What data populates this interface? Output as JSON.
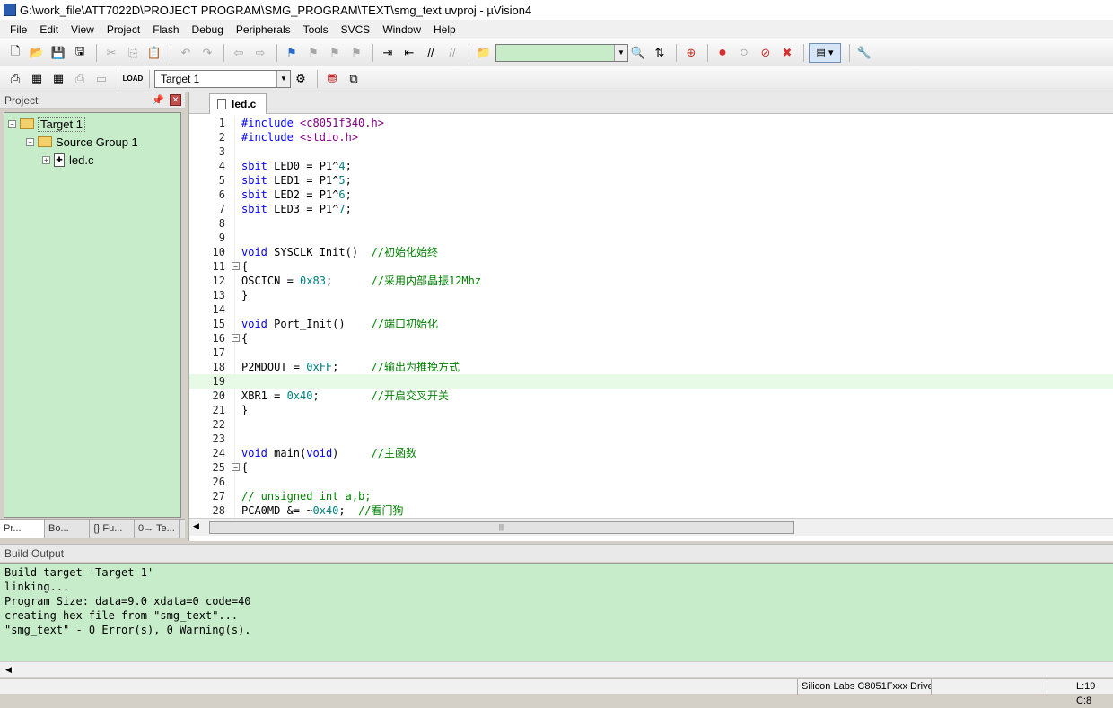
{
  "window": {
    "title": "G:\\work_file\\ATT7022D\\PROJECT PROGRAM\\SMG_PROGRAM\\TEXT\\smg_text.uvproj - µVision4"
  },
  "menu": [
    "File",
    "Edit",
    "View",
    "Project",
    "Flash",
    "Debug",
    "Peripherals",
    "Tools",
    "SVCS",
    "Window",
    "Help"
  ],
  "toolbar": {
    "target_select": "Target 1",
    "find_value": ""
  },
  "project_pane": {
    "title": "Project",
    "tree": {
      "target": "Target 1",
      "group": "Source Group 1",
      "file": "led.c"
    },
    "tabs": [
      "Pr...",
      "Bo...",
      "{} Fu...",
      "0→ Te..."
    ]
  },
  "editor": {
    "tab": "led.c",
    "lines": [
      {
        "n": "1",
        "parts": [
          [
            "pp",
            "#include "
          ],
          [
            "str",
            "<c8051f340.h>"
          ]
        ]
      },
      {
        "n": "2",
        "parts": [
          [
            "pp",
            "#include "
          ],
          [
            "str",
            "<stdio.h>"
          ]
        ]
      },
      {
        "n": "3",
        "parts": []
      },
      {
        "n": "4",
        "parts": [
          [
            "kw",
            "sbit"
          ],
          [
            "",
            " LED0 = P1^"
          ],
          [
            "num",
            "4"
          ],
          [
            "",
            ";"
          ]
        ]
      },
      {
        "n": "5",
        "parts": [
          [
            "kw",
            "sbit"
          ],
          [
            "",
            " LED1 = P1^"
          ],
          [
            "num",
            "5"
          ],
          [
            "",
            ";"
          ]
        ]
      },
      {
        "n": "6",
        "parts": [
          [
            "kw",
            "sbit"
          ],
          [
            "",
            " LED2 = P1^"
          ],
          [
            "num",
            "6"
          ],
          [
            "",
            ";"
          ]
        ]
      },
      {
        "n": "7",
        "parts": [
          [
            "kw",
            "sbit"
          ],
          [
            "",
            " LED3 = P1^"
          ],
          [
            "num",
            "7"
          ],
          [
            "",
            ";"
          ]
        ]
      },
      {
        "n": "8",
        "parts": []
      },
      {
        "n": "9",
        "parts": []
      },
      {
        "n": "10",
        "parts": [
          [
            "kw",
            "void"
          ],
          [
            "",
            " SYSCLK_Init()  "
          ],
          [
            "cmt",
            "//初始化始终"
          ]
        ]
      },
      {
        "n": "11",
        "fold": true,
        "parts": [
          [
            "",
            "{"
          ]
        ]
      },
      {
        "n": "12",
        "parts": [
          [
            "",
            "OSCICN = "
          ],
          [
            "num",
            "0x83"
          ],
          [
            "",
            ";      "
          ],
          [
            "cmt",
            "//采用内部晶振12Mhz"
          ]
        ]
      },
      {
        "n": "13",
        "parts": [
          [
            "",
            "}"
          ]
        ]
      },
      {
        "n": "14",
        "parts": []
      },
      {
        "n": "15",
        "parts": [
          [
            "kw",
            "void"
          ],
          [
            "",
            " Port_Init()    "
          ],
          [
            "cmt",
            "//端口初始化"
          ]
        ]
      },
      {
        "n": "16",
        "fold": true,
        "parts": [
          [
            "",
            "{"
          ]
        ]
      },
      {
        "n": "17",
        "parts": []
      },
      {
        "n": "18",
        "parts": [
          [
            "",
            "P2MDOUT = "
          ],
          [
            "num",
            "0xFF"
          ],
          [
            "",
            ";     "
          ],
          [
            "cmt",
            "//输出为推挽方式"
          ]
        ]
      },
      {
        "n": "19",
        "hl": true,
        "parts": []
      },
      {
        "n": "20",
        "parts": [
          [
            "",
            "XBR1 = "
          ],
          [
            "num",
            "0x40"
          ],
          [
            "",
            ";        "
          ],
          [
            "cmt",
            "//开启交叉开关"
          ]
        ]
      },
      {
        "n": "21",
        "parts": [
          [
            "",
            "}"
          ]
        ]
      },
      {
        "n": "22",
        "parts": []
      },
      {
        "n": "23",
        "parts": []
      },
      {
        "n": "24",
        "parts": [
          [
            "kw",
            "void"
          ],
          [
            "",
            " main("
          ],
          [
            "kw",
            "void"
          ],
          [
            "",
            ")     "
          ],
          [
            "cmt",
            "//主函数"
          ]
        ]
      },
      {
        "n": "25",
        "fold": true,
        "parts": [
          [
            "",
            "{"
          ]
        ]
      },
      {
        "n": "26",
        "parts": []
      },
      {
        "n": "27",
        "parts": [
          [
            "cmt",
            "// unsigned int a,b;"
          ]
        ]
      },
      {
        "n": "28",
        "parts": [
          [
            "",
            "PCA0MD &= ~"
          ],
          [
            "num",
            "0x40"
          ],
          [
            "",
            ";  "
          ],
          [
            "cmt",
            "//看门狗"
          ]
        ]
      }
    ]
  },
  "build_output": {
    "title": "Build Output",
    "lines": [
      "Build target 'Target 1'",
      "linking...",
      "Program Size: data=9.0 xdata=0 code=40",
      "creating hex file from \"smg_text\"...",
      "\"smg_text\" - 0 Error(s), 0 Warning(s)."
    ]
  },
  "status": {
    "driver": "Silicon Labs C8051Fxxx Driver",
    "position": "L:19 C:8"
  }
}
